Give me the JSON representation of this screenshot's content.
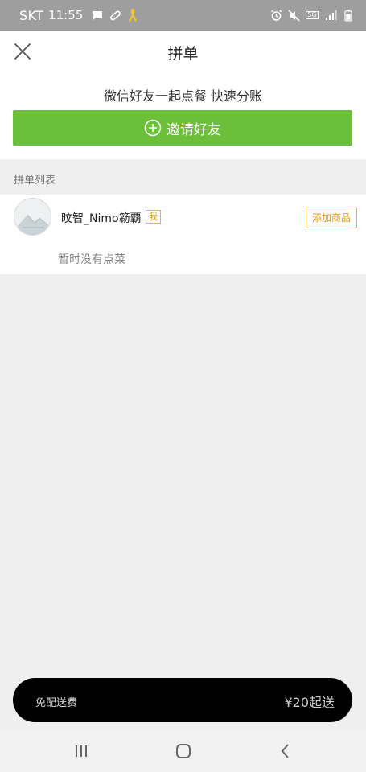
{
  "status_bar": {
    "carrier": "SKT",
    "time": "11:55",
    "icons_left": [
      "chat-bubble-icon",
      "bandage-icon",
      "ribbon-icon"
    ],
    "icons_right": [
      "alarm-icon",
      "mute-icon",
      "5g-icon",
      "signal-icon",
      "battery-icon"
    ],
    "network": "5G"
  },
  "header": {
    "title": "拼单",
    "close_icon": "close-icon"
  },
  "invite": {
    "text": "微信好友一起点餐 快速分账",
    "button_label": "邀请好友",
    "button_icon": "plus-circle-icon",
    "accent_color": "#6bbf3a"
  },
  "list": {
    "title": "拼单列表",
    "members": [
      {
        "name": "旼智_Nimo簕覇",
        "badge": "我",
        "add_button": "添加商品",
        "empty_text": "暂时没有点菜"
      }
    ]
  },
  "checkout": {
    "free_delivery": "免配送费",
    "min_order": "¥20起送"
  },
  "nav_bar": {
    "buttons": [
      "recent-apps-icon",
      "home-icon",
      "back-icon"
    ]
  }
}
